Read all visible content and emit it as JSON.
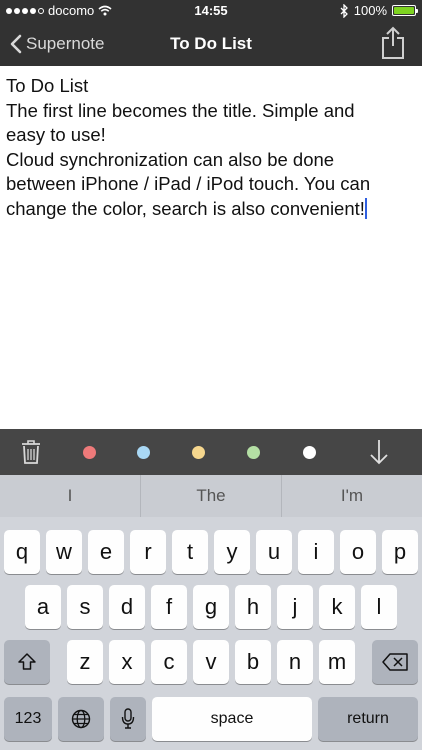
{
  "status_bar": {
    "carrier": "docomo",
    "time": "14:55",
    "battery": "100%",
    "battery_level": 1.0
  },
  "nav": {
    "back_label": "Supernote",
    "title": "To Do List"
  },
  "note": {
    "lines": [
      "To Do List",
      "The first line becomes the title. Simple and",
      "easy to use!",
      "Cloud synchronization can also be done",
      "between iPhone / iPad / iPod touch. You can",
      "change the color, search is also convenient!"
    ]
  },
  "toolbar": {
    "colors": [
      "#ee7a7a",
      "#a9d8f5",
      "#f6d78e",
      "#b4dfa4",
      "#ffffff"
    ]
  },
  "keyboard": {
    "suggestions": [
      "I",
      "The",
      "I'm"
    ],
    "row1": [
      "q",
      "w",
      "e",
      "r",
      "t",
      "y",
      "u",
      "i",
      "o",
      "p"
    ],
    "row2": [
      "a",
      "s",
      "d",
      "f",
      "g",
      "h",
      "j",
      "k",
      "l"
    ],
    "row3": [
      "z",
      "x",
      "c",
      "v",
      "b",
      "n",
      "m"
    ],
    "numbers_label": "123",
    "space_label": "space",
    "return_label": "return"
  }
}
